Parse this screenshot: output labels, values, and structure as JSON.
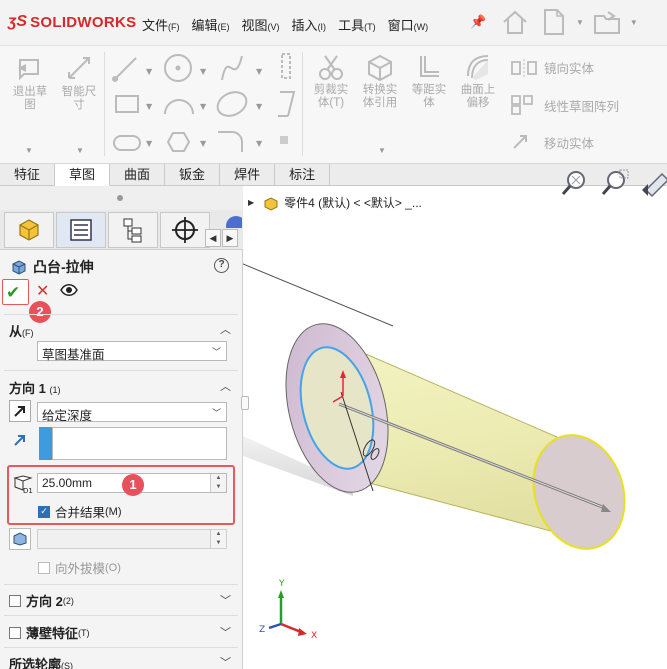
{
  "app": {
    "logo_text": "SOLIDWORKS",
    "menus": [
      {
        "label": "文件",
        "key": "(F)"
      },
      {
        "label": "编辑",
        "key": "(E)"
      },
      {
        "label": "视图",
        "key": "(V)"
      },
      {
        "label": "插入",
        "key": "(I)"
      },
      {
        "label": "工具",
        "key": "(T)"
      },
      {
        "label": "窗口",
        "key": "(W)"
      }
    ]
  },
  "ribbon": {
    "exit_sketch": [
      "退出草",
      "图"
    ],
    "smart_dimension": [
      "智能尺",
      "寸"
    ],
    "trim": [
      "剪裁实",
      "体(T)"
    ],
    "convert": [
      "转换实",
      "体引用"
    ],
    "offset": [
      "等距实",
      "体"
    ],
    "surface_offset": [
      "曲面上",
      "偏移"
    ],
    "mirror": "镜向实体",
    "linear_pattern": "线性草图阵列",
    "move": "移动实体"
  },
  "tabs": [
    "特征",
    "草图",
    "曲面",
    "钣金",
    "焊件",
    "标注"
  ],
  "active_tab": 1,
  "feature": {
    "title": "凸台-拉伸",
    "help": "?",
    "from_label": "从",
    "from_key": "(F)",
    "from_value": "草图基准面",
    "dir1_label": "方向 1",
    "dir1_key": "(1)",
    "end_condition": "给定深度",
    "depth": "25.00mm",
    "depth_symbol": "D1",
    "merge_label": "合并结果",
    "merge_key": "(M)",
    "draft_outward": "向外拔模",
    "draft_key": "(O)",
    "dir2_label": "方向 2",
    "dir2_key": "(2)",
    "thin_label": "薄壁特征",
    "thin_key": "(T)",
    "contours_label": "所选轮廓",
    "contours_key": "(S)",
    "badge1": "1",
    "badge2": "2"
  },
  "graphics": {
    "breadcrumb": "零件4 (默认) < <默认> _...",
    "triad": {
      "x": "X",
      "y": "Y",
      "z": "Z"
    }
  },
  "colors": {
    "brand_red": "#d62a2a",
    "highlight_red": "#e85a5a",
    "badge_red": "#e8505b",
    "ok_green": "#2a9a2a",
    "selection_blue": "#3f9be0",
    "body_yellow": "#f0f0b8",
    "flange_mauve": "#d8c8d8"
  }
}
